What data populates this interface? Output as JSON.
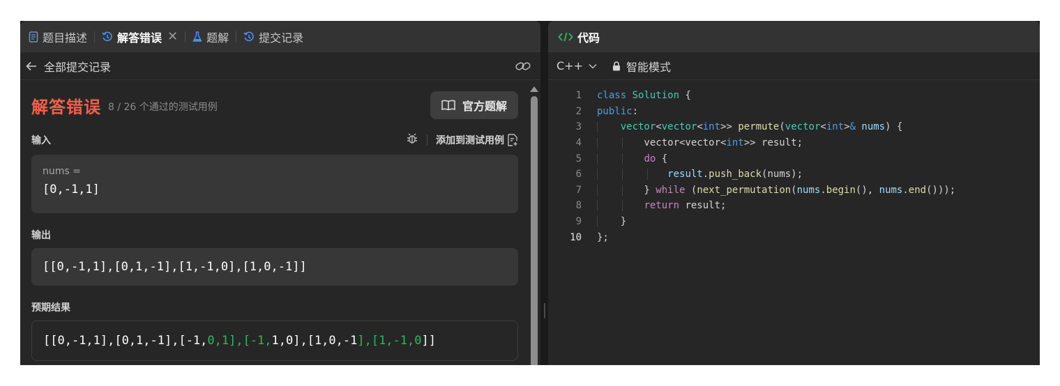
{
  "tabs": [
    {
      "label": "题目描述",
      "icon": "document-icon",
      "active": false
    },
    {
      "label": "解答错误",
      "icon": "history-icon",
      "active": true
    },
    {
      "label": "题解",
      "icon": "flask-icon",
      "active": false
    },
    {
      "label": "提交记录",
      "icon": "history-icon",
      "active": false
    }
  ],
  "subheader": {
    "back_label": "全部提交记录"
  },
  "result": {
    "status": "解答错误",
    "pass_count": "8 / 26 个通过的测试用例",
    "solution_button": "官方题解",
    "input_label": "输入",
    "add_testcase_label": "添加到测试用例",
    "nums_label": "nums =",
    "nums_value": "[0,-1,1]",
    "output_label": "输出",
    "output_value": "[[0,-1,1],[0,1,-1],[1,-1,0],[1,0,-1]]",
    "expected_label": "预期结果",
    "expected_parts": {
      "p1": "[[0,-1,1],[0,1,-1],[-1,",
      "d1": "0,1],[-1,",
      "p2": "1,0],[1,0,-1",
      "d2": "],[1,-1,0",
      "p3": "]]"
    },
    "status_color": "#f35f4b",
    "diff_color": "#2cbb5d"
  },
  "code_panel": {
    "title": "代码",
    "language": "C++",
    "mode": "智能模式",
    "line_numbers": [
      "1",
      "2",
      "3",
      "4",
      "5",
      "6",
      "7",
      "8",
      "9",
      "10"
    ],
    "lines": [
      "class Solution {",
      "public:",
      "    vector<vector<int>> permute(vector<int>& nums) {",
      "        vector<vector<int>> result;",
      "        do {",
      "            result.push_back(nums);",
      "        } while (next_permutation(nums.begin(), nums.end()));",
      "        return result;",
      "    }",
      "};"
    ]
  }
}
